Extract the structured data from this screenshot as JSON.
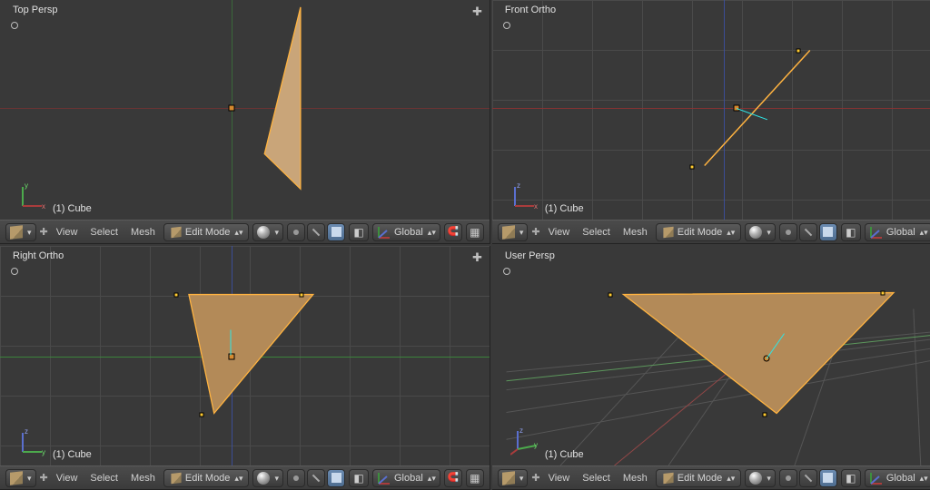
{
  "views": {
    "top": {
      "title": "Top Persp",
      "object": "(1) Cube",
      "gizmo": "xy"
    },
    "front": {
      "title": "Front Ortho",
      "object": "(1) Cube",
      "gizmo": "xz"
    },
    "right": {
      "title": "Right Ortho",
      "object": "(1) Cube",
      "gizmo": "zy"
    },
    "user": {
      "title": "User Persp",
      "object": "(1) Cube",
      "gizmo": "xyz"
    }
  },
  "header": {
    "menu_view": "View",
    "menu_select": "Select",
    "menu_mesh": "Mesh",
    "mode_label": "Edit Mode",
    "orient_label": "Global"
  },
  "colors": {
    "face_fill": "#c9a579",
    "face_fill_dk": "#b38a58",
    "edge_sel": "#ffb340",
    "vert_sel": "#ffcc33",
    "normal": "#2ee6e6",
    "axis_x": "#aa3c3c",
    "axis_y": "#4caa4c",
    "axis_z": "#4455bb"
  },
  "icons": {
    "dropdown": "▾▴",
    "plus": "✚"
  }
}
